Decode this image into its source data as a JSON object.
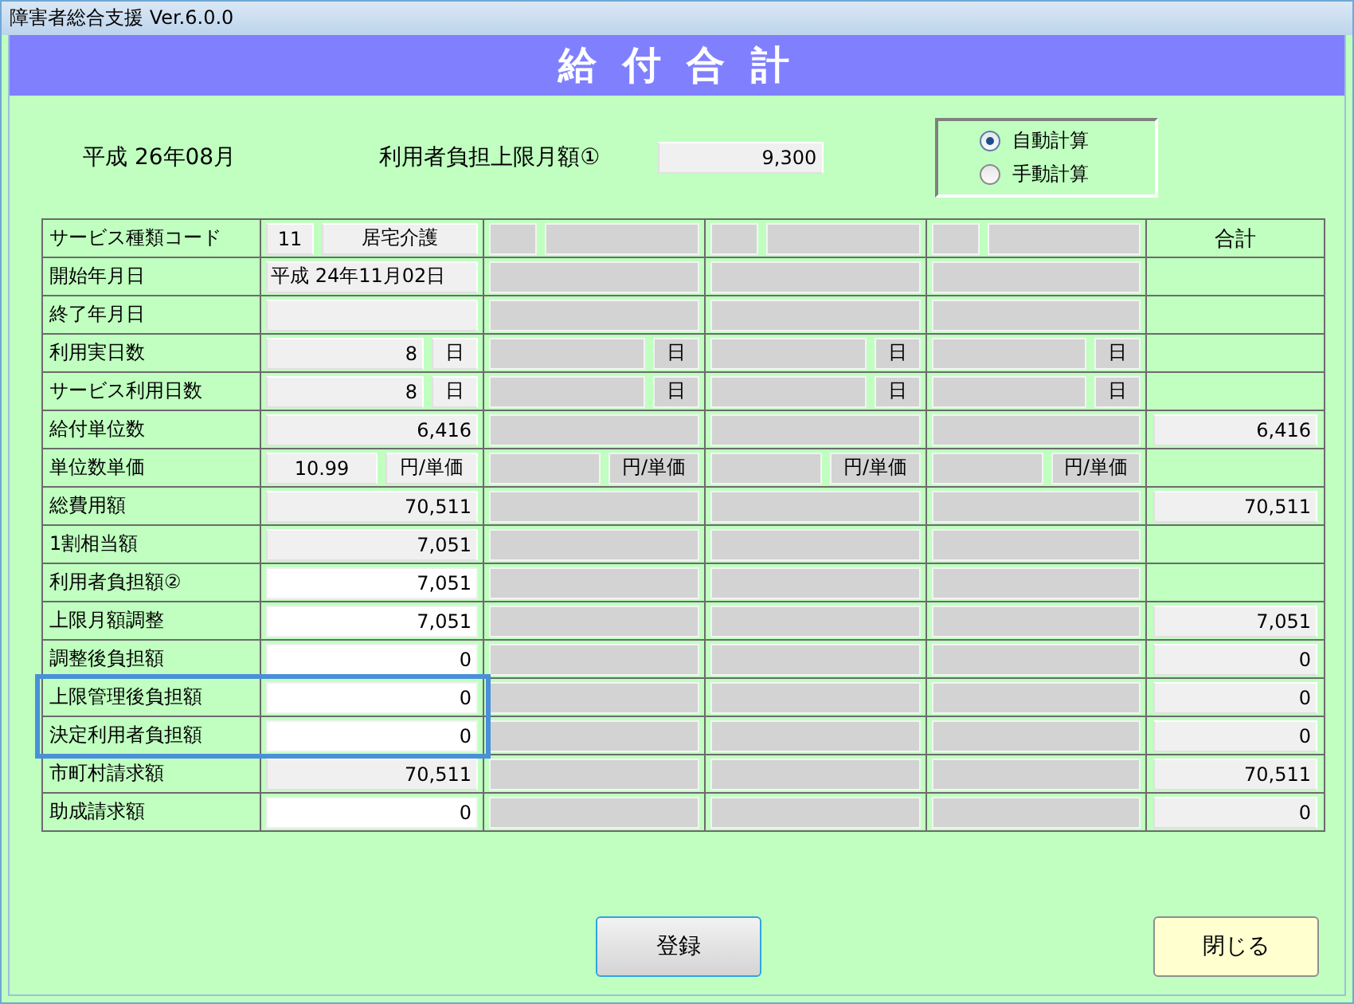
{
  "window": {
    "title": "障害者総合支援 Ver.6.0.0"
  },
  "header": {
    "title": "給 付 合 計"
  },
  "summary": {
    "month": "平成 26年08月",
    "limit_label": "利用者負担上限月額①",
    "limit_value": "9,300"
  },
  "calc_mode": [
    {
      "label": "自動計算",
      "selected": true
    },
    {
      "label": "手動計算",
      "selected": false
    }
  ],
  "rows": [
    {
      "label": "サービス種類コード",
      "kind": "code",
      "cells": [
        {
          "code": "11",
          "name": "居宅介護",
          "disabled": false
        },
        {
          "disabled": true
        },
        {
          "disabled": true
        },
        {
          "disabled": true
        }
      ],
      "total": {
        "kind": "heading",
        "text": "合計"
      }
    },
    {
      "label": "開始年月日",
      "kind": "text",
      "cells": [
        {
          "value": "平成 24年11月02日",
          "disabled": false,
          "editable": false
        },
        {
          "disabled": true
        },
        {
          "disabled": true
        },
        {
          "disabled": true
        }
      ]
    },
    {
      "label": "終了年月日",
      "kind": "text",
      "cells": [
        {
          "disabled": false,
          "editable": false
        },
        {
          "disabled": true
        },
        {
          "disabled": true
        },
        {
          "disabled": true
        }
      ]
    },
    {
      "label": "利用実日数",
      "kind": "unit",
      "cells": [
        {
          "value": "8",
          "unit": "日",
          "disabled": false,
          "editable": false
        },
        {
          "unit": "日",
          "disabled": true
        },
        {
          "unit": "日",
          "disabled": true
        },
        {
          "unit": "日",
          "disabled": true
        }
      ]
    },
    {
      "label": "サービス利用日数",
      "kind": "unit",
      "cells": [
        {
          "value": "8",
          "unit": "日",
          "disabled": false,
          "editable": false
        },
        {
          "unit": "日",
          "disabled": true
        },
        {
          "unit": "日",
          "disabled": true
        },
        {
          "unit": "日",
          "disabled": true
        }
      ]
    },
    {
      "label": "給付単位数",
      "kind": "amount",
      "cells": [
        {
          "value": "6,416",
          "disabled": false,
          "editable": false
        },
        {
          "disabled": true
        },
        {
          "disabled": true
        },
        {
          "disabled": true
        }
      ],
      "total": {
        "kind": "field",
        "text": "6,416"
      }
    },
    {
      "label": "単位数単価",
      "kind": "price",
      "cells": [
        {
          "value": "10.99",
          "unit": "円/単価",
          "disabled": false,
          "editable": false
        },
        {
          "unit": "円/単価",
          "disabled": true
        },
        {
          "unit": "円/単価",
          "disabled": true
        },
        {
          "unit": "円/単価",
          "disabled": true
        }
      ]
    },
    {
      "label": "総費用額",
      "kind": "amount",
      "cells": [
        {
          "value": "70,511",
          "disabled": false,
          "editable": false
        },
        {
          "disabled": true
        },
        {
          "disabled": true
        },
        {
          "disabled": true
        }
      ],
      "total": {
        "kind": "field",
        "text": "70,511"
      }
    },
    {
      "label": "1割相当額",
      "kind": "amount",
      "cells": [
        {
          "value": "7,051",
          "disabled": false,
          "editable": false
        },
        {
          "disabled": true
        },
        {
          "disabled": true
        },
        {
          "disabled": true
        }
      ]
    },
    {
      "label": "利用者負担額②",
      "kind": "amount",
      "cells": [
        {
          "value": "7,051",
          "disabled": false,
          "editable": true
        },
        {
          "disabled": true
        },
        {
          "disabled": true
        },
        {
          "disabled": true
        }
      ]
    },
    {
      "label": "上限月額調整",
      "kind": "amount",
      "cells": [
        {
          "value": "7,051",
          "disabled": false,
          "editable": true
        },
        {
          "disabled": true
        },
        {
          "disabled": true
        },
        {
          "disabled": true
        }
      ],
      "total": {
        "kind": "field",
        "text": "7,051"
      }
    },
    {
      "label": "調整後負担額",
      "kind": "amount",
      "cells": [
        {
          "value": "0",
          "disabled": false,
          "editable": true
        },
        {
          "disabled": true
        },
        {
          "disabled": true
        },
        {
          "disabled": true
        }
      ],
      "total": {
        "kind": "field",
        "text": "0"
      }
    },
    {
      "label": "上限管理後負担額",
      "kind": "amount",
      "highlighted": true,
      "cells": [
        {
          "value": "0",
          "disabled": false,
          "editable": true
        },
        {
          "disabled": true
        },
        {
          "disabled": true
        },
        {
          "disabled": true
        }
      ],
      "total": {
        "kind": "field",
        "text": "0"
      }
    },
    {
      "label": "決定利用者負担額",
      "kind": "amount",
      "highlighted": true,
      "cells": [
        {
          "value": "0",
          "disabled": false,
          "editable": true
        },
        {
          "disabled": true
        },
        {
          "disabled": true
        },
        {
          "disabled": true
        }
      ],
      "total": {
        "kind": "field",
        "text": "0"
      }
    },
    {
      "label": "市町村請求額",
      "kind": "amount",
      "cells": [
        {
          "value": "70,511",
          "disabled": false,
          "editable": false
        },
        {
          "disabled": true
        },
        {
          "disabled": true
        },
        {
          "disabled": true
        }
      ],
      "total": {
        "kind": "field",
        "text": "70,511"
      }
    },
    {
      "label": "助成請求額",
      "kind": "amount",
      "cells": [
        {
          "value": "0",
          "disabled": false,
          "editable": true
        },
        {
          "disabled": true
        },
        {
          "disabled": true
        },
        {
          "disabled": true
        }
      ],
      "total": {
        "kind": "field",
        "text": "0"
      }
    }
  ],
  "buttons": [
    {
      "label": "登録",
      "kind": "primary"
    },
    {
      "label": "閉じる",
      "kind": "close"
    }
  ]
}
